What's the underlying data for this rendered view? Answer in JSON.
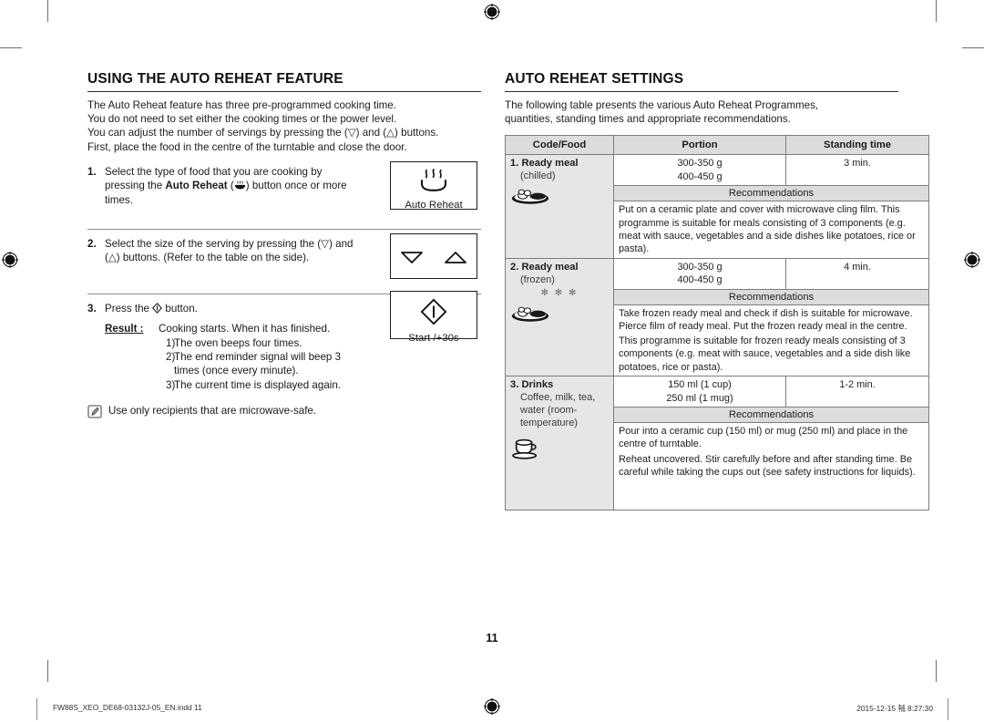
{
  "document": {
    "page_number": "11",
    "footer_left": "FW88S_XEO_DE68-03132J-05_EN.indd   11",
    "footer_right": "2015-12-15   ㍻ 8:27:30"
  },
  "left_column": {
    "title": "Using the auto reheat feature",
    "intro_lines": [
      "The Auto Reheat feature has three pre-programmed cooking time.",
      "You do not need to set either the cooking times or the power level.",
      "You can adjust the number of servings by pressing the (▽) and (△) buttons.",
      "First, place the food in the centre of the turntable and close the door."
    ],
    "steps": [
      {
        "number": "1.",
        "lines": [
          "Select the type of food that you are cooking by",
          "pressing the Auto Reheat (icon) button once or more",
          "times."
        ],
        "text_before_bold": "pressing the ",
        "bold_text": "Auto Reheat",
        "text_after_bold": " button once or more",
        "key": {
          "name": "auto-reheat",
          "label": "Auto Reheat",
          "icon": "steam-dish-icon"
        }
      },
      {
        "number": "2.",
        "lines": [
          "Select the size of the serving by pressing the (▽) and",
          "(△) buttons. (Refer to the table on the side)."
        ],
        "key": {
          "name": "serving-size",
          "label": "",
          "icon": "down-up-arrows-icon"
        }
      },
      {
        "number": "3.",
        "lines": [
          "Press the (◇) button."
        ],
        "key": {
          "name": "start-30s",
          "label": "Start /+30s",
          "icon": "start-diamond-icon"
        }
      }
    ],
    "result": {
      "label": "Result :",
      "headline": "Cooking starts. When it has finished.",
      "items": [
        {
          "index": "1)",
          "text": "The oven beeps four times."
        },
        {
          "index": "2)",
          "text": "The end reminder signal will beep 3"
        },
        {
          "index": "2b",
          "text": "times (once every minute)."
        },
        {
          "index": "3)",
          "text": "The current time is displayed again."
        }
      ]
    },
    "note": {
      "icon": "note-pencil-icon",
      "text": "Use only recipients that are microwave-safe."
    }
  },
  "right_column": {
    "title": "Auto reheat settings",
    "intro_lines": [
      "The following table presents the various Auto Reheat Programmes,",
      "quantities, standing times and appropriate recommendations."
    ],
    "table": {
      "headers": [
        "Code/Food",
        "Portion",
        "Standing time"
      ],
      "recommendations_header": "Recommendations",
      "rows": [
        {
          "code_name": "1. Ready meal",
          "code_sub": "(chilled)",
          "frozen_marks": "",
          "icon": "ready-meal-icon",
          "portion": [
            "300-350 g",
            "400-450 g"
          ],
          "standing_time": "3 min.",
          "recommendations": [
            "Put on a ceramic plate and cover with microwave cling film. This programme is suitable for meals consisting of 3 components (e.g. meat with sauce, vegetables and a side dishes like potatoes, rice or pasta)."
          ]
        },
        {
          "code_name": "2. Ready meal",
          "code_sub": "(frozen)",
          "frozen_marks": "✻ ✻ ✻",
          "icon": "frozen-ready-meal-icon",
          "portion": [
            "300-350 g",
            "400-450 g"
          ],
          "standing_time": "4 min.",
          "recommendations": [
            "Take frozen ready meal and check if dish is suitable for microwave. Pierce film of ready meal. Put the frozen ready meal in the centre.",
            "This programme is suitable for frozen ready meals consisting of 3 components (e.g. meat with sauce, vegetables and a side dish like potatoes, rice or pasta)."
          ]
        },
        {
          "code_name": "3. Drinks",
          "code_sub": "Coffee, milk, tea, water (room-temperature)",
          "frozen_marks": "",
          "icon": "coffee-cup-icon",
          "portion": [
            "150 ml (1 cup)",
            "250 ml (1 mug)"
          ],
          "standing_time": "1-2 min.",
          "recommendations": [
            "Pour into a ceramic cup (150 ml) or mug (250 ml) and place in the centre of turntable.",
            "Reheat uncovered. Stir carefully before and after standing time. Be careful while taking the cups out (see safety instructions for liquids)."
          ]
        }
      ]
    }
  }
}
